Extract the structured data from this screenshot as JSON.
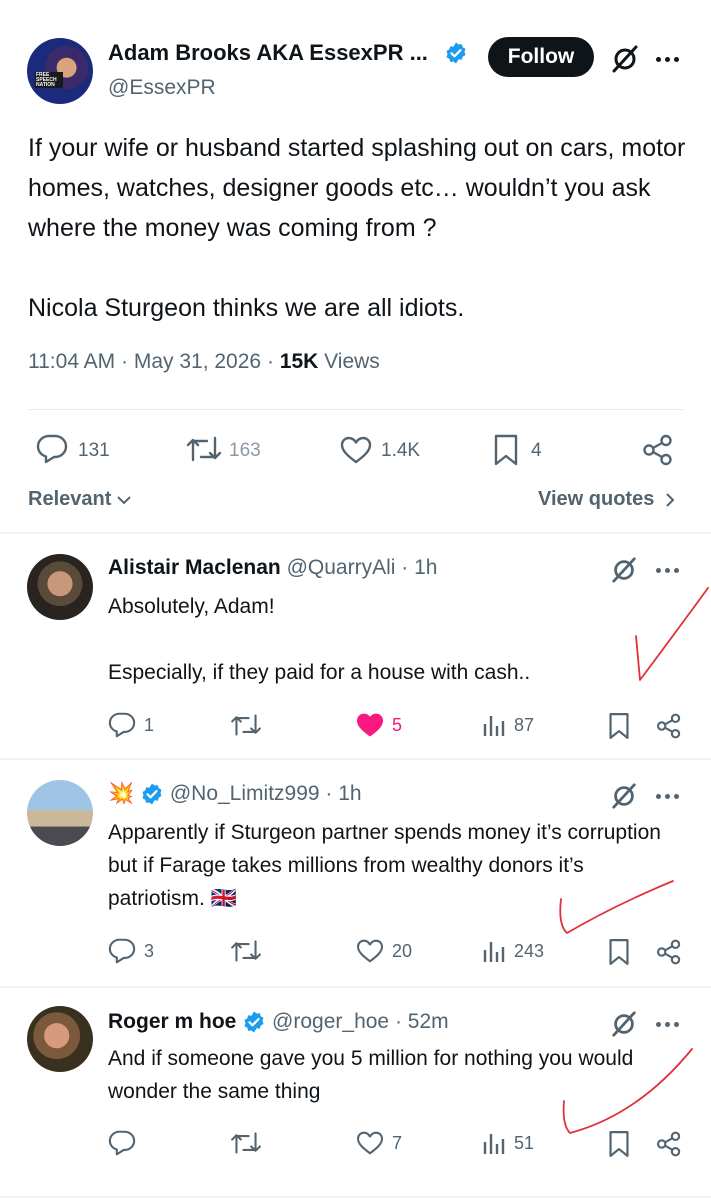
{
  "main_post": {
    "author_name": "Adam Brooks AKA EssexPR ...",
    "author_handle": "@EssexPR",
    "follow_label": "Follow",
    "avatar_text": "FREE SPEECH NATION",
    "text_lines": [
      "If your wife or husband started splashing out on cars, motor homes, watches, designer goods etc… wouldn’t you ask where the money was coming from ?",
      "Nicola Sturgeon thinks we are all idiots."
    ],
    "time": "11:04 AM",
    "date": "May 31, 2026",
    "views_count": "15K",
    "views_label": "Views",
    "replies": "131",
    "reposts": "163",
    "likes": "1.4K",
    "bookmarks": "4",
    "sort_label": "Relevant",
    "view_quotes_label": "View quotes"
  },
  "replies": [
    {
      "name": "Alistair Maclenan",
      "handle": "@QuarryAli",
      "time": "· 1h",
      "text_lines": [
        "Absolutely, Adam!",
        "Especially, if they paid for a house with cash.."
      ],
      "replies": "1",
      "reposts": "",
      "likes": "5",
      "liked": true,
      "views": "87"
    },
    {
      "name": "💥",
      "handle": "@No_Limitz999",
      "time": "· 1h",
      "text_lines": [
        "Apparently if Sturgeon partner spends money it’s corruption but if Farage takes millions from wealthy donors it’s patriotism. 🇬🇧"
      ],
      "replies": "3",
      "reposts": "",
      "likes": "20",
      "liked": false,
      "views": "243"
    },
    {
      "name": "Roger m hoe",
      "handle": "@roger_hoe",
      "time": "· 52m",
      "text_lines": [
        "And if someone gave you 5 million for nothing you would wonder the same thing"
      ],
      "replies": "",
      "reposts": "",
      "likes": "7",
      "liked": false,
      "views": "51"
    }
  ],
  "colors": {
    "verified_blue": "#1d9bf0",
    "like_pink": "#f91880",
    "annotation_red": "#e0313a",
    "text_secondary": "#536471"
  }
}
